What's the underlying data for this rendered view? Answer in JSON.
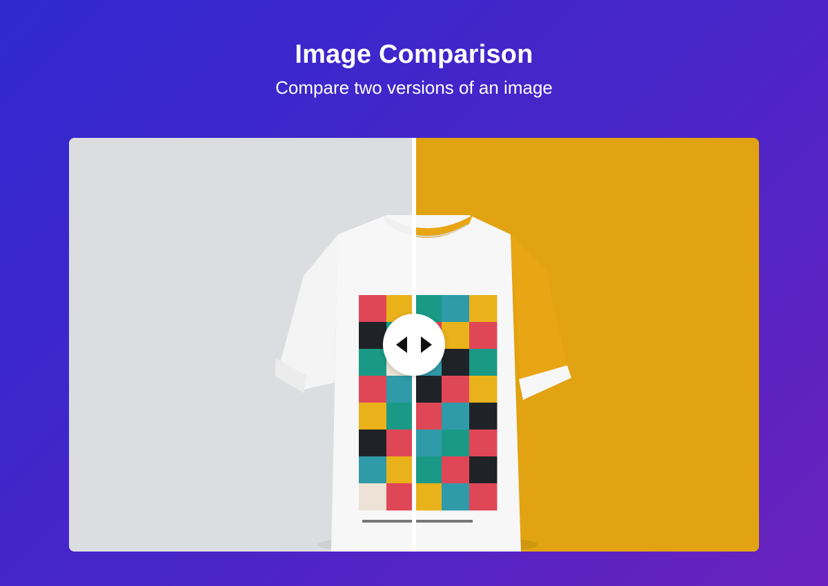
{
  "header": {
    "title": "Image Comparison",
    "subtitle": "Compare two versions of an image"
  },
  "comparison": {
    "slider_position": 0.5,
    "before": {
      "background_color": "#dcdde0",
      "shirt_color": "#f7f7f7",
      "sleeve_color": "#f7f7f7"
    },
    "after": {
      "background_color": "#e1a312",
      "shirt_color": "#f7f7f7",
      "sleeve_color": "#e8a514"
    },
    "handle_icons": [
      "arrow-left-icon",
      "arrow-right-icon"
    ],
    "print_palette": [
      "#df4757",
      "#e9b21b",
      "#1a9a86",
      "#2f9aa8",
      "#1f2327",
      "#ece3d6"
    ]
  }
}
